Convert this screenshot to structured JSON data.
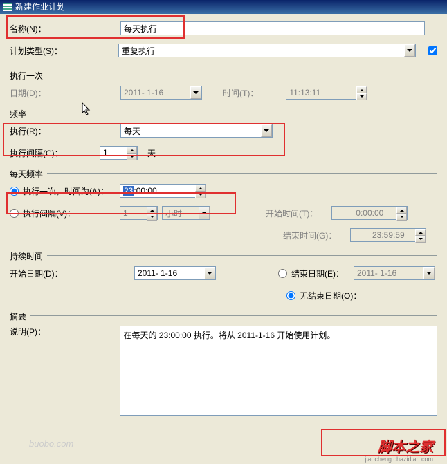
{
  "window": {
    "title": "新建作业计划"
  },
  "name": {
    "label": "名称(N)：",
    "value": "每天执行"
  },
  "planType": {
    "label": "计划类型(S)：",
    "value": "重复执行"
  },
  "once": {
    "legend": "执行一次",
    "dateLabel": "日期(D)：",
    "dateValue": "2011- 1-16",
    "timeLabel": "时间(T)：",
    "timeValue": "11:13:11"
  },
  "freq": {
    "legend": "频率",
    "execLabel": "执行(R)：",
    "execValue": "每天",
    "intervalLabel": "执行间隔(C)：",
    "intervalValue": "1",
    "intervalUnit": "天"
  },
  "daily": {
    "legend": "每天频率",
    "onceLabel": "执行一次，时间为(A)：",
    "onceValueSel": "23",
    "onceValueRest": ":00:00",
    "intLabel": "执行间隔(V)：",
    "intValue": "1",
    "intUnit": "小时",
    "startLabel": "开始时间(T)：",
    "startValue": "0:00:00",
    "endLabel": "结束时间(G)：",
    "endValue": "23:59:59"
  },
  "duration": {
    "legend": "持续时间",
    "startDateLabel": "开始日期(D)：",
    "startDateValue": "2011- 1-16",
    "endDateLabel": "结束日期(E)：",
    "endDateValue": "2011- 1-16",
    "noEndLabel": "无结束日期(O)："
  },
  "summary": {
    "legend": "摘要",
    "descLabel": "说明(P)：",
    "descValue": "在每天的 23:00:00 执行。将从 2011-1-16 开始使用计划。"
  },
  "watermark": "buobo.com",
  "footer": {
    "logo": "脚本之家",
    "sub": "jiaocheng.chazidian.com"
  }
}
